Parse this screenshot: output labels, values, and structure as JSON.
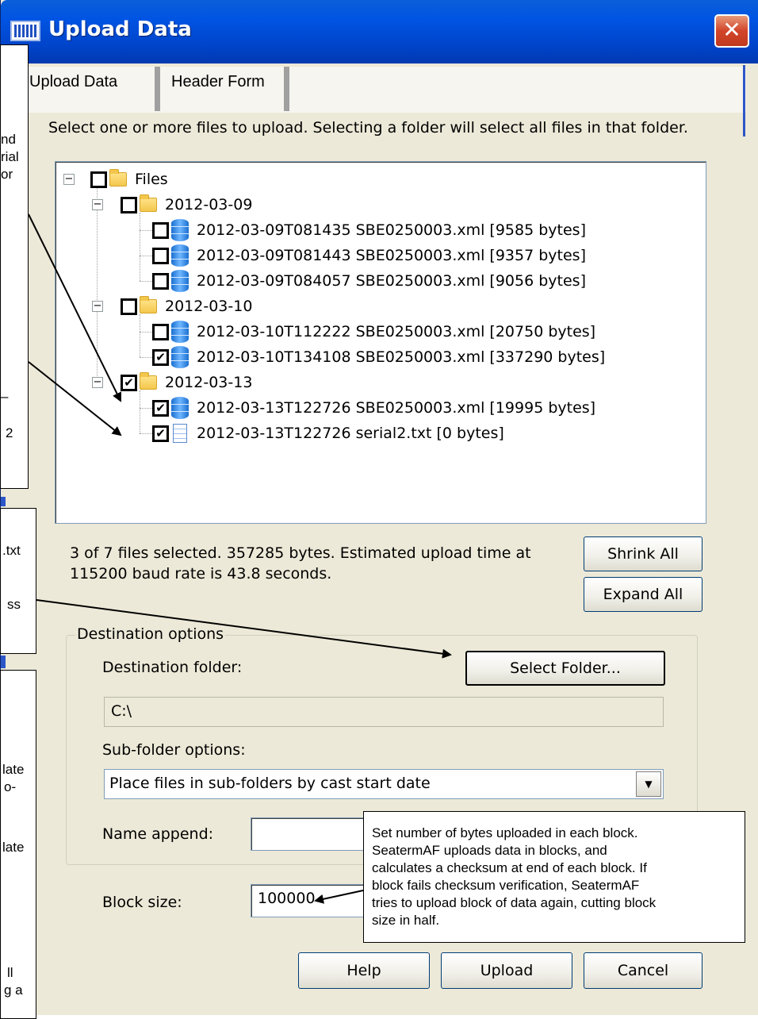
{
  "window": {
    "title": "Upload Data",
    "close_label": "✕"
  },
  "tabs": [
    {
      "label": "Upload Data",
      "active": true
    },
    {
      "label": "Header Form",
      "active": false
    }
  ],
  "instruction": "Select one or more files to upload.  Selecting a folder will select all files in that folder.",
  "tree": {
    "root": {
      "label": "Files",
      "checked": false
    },
    "folders": [
      {
        "label": "2012-03-09",
        "checked": false,
        "files": [
          {
            "label": "2012-03-09T081435 SBE0250003.xml [9585 bytes]",
            "checked": false,
            "icon": "database-icon"
          },
          {
            "label": "2012-03-09T081443 SBE0250003.xml [9357 bytes]",
            "checked": false,
            "icon": "database-icon"
          },
          {
            "label": "2012-03-09T084057 SBE0250003.xml [9056 bytes]",
            "checked": false,
            "icon": "database-icon"
          }
        ]
      },
      {
        "label": "2012-03-10",
        "checked": false,
        "files": [
          {
            "label": "2012-03-10T112222 SBE0250003.xml [20750 bytes]",
            "checked": false,
            "icon": "database-icon"
          },
          {
            "label": "2012-03-10T134108 SBE0250003.xml [337290 bytes]",
            "checked": true,
            "icon": "database-icon"
          }
        ]
      },
      {
        "label": "2012-03-13",
        "checked": true,
        "files": [
          {
            "label": "2012-03-13T122726 SBE0250003.xml [19995 bytes]",
            "checked": true,
            "icon": "database-icon"
          },
          {
            "label": "2012-03-13T122726 serial2.txt [0 bytes]",
            "checked": true,
            "icon": "text-file-icon"
          }
        ]
      }
    ]
  },
  "status": {
    "line1": "3 of 7 files selected. 357285 bytes. Estimated upload time at",
    "line2": "115200 baud rate is 43.8 seconds."
  },
  "buttons": {
    "shrink_all": "Shrink All",
    "expand_all": "Expand All",
    "select_folder": "Select Folder...",
    "help": "Help",
    "upload": "Upload",
    "cancel": "Cancel"
  },
  "destination": {
    "group_label": "Destination options",
    "folder_label": "Destination folder:",
    "folder_value": "C:\\",
    "subfolder_label": "Sub-folder options:",
    "subfolder_value": "Place files in sub-folders by cast start date",
    "name_append_label": "Name append:",
    "name_append_value": ""
  },
  "block": {
    "label": "Block size:",
    "value": "100000"
  },
  "callouts": {
    "top_left": [
      "nd",
      "rial",
      "or",
      "",
      "",
      "",
      "",
      "",
      "",
      "",
      "",
      "",
      "",
      "",
      "–",
      "",
      "2"
    ],
    "middle_left": [
      ".txt",
      "",
      "",
      "ss"
    ],
    "bottom_left": [
      "late",
      "o-",
      "",
      "",
      "late",
      "",
      "",
      "",
      "",
      "",
      "",
      "ll",
      "g a"
    ],
    "block_size": [
      "Set number of bytes uploaded in each block.",
      "SeatermAF uploads data in blocks, and",
      "calculates a checksum at end of each block. If",
      "block fails checksum verification, SeatermAF",
      "tries to upload block of data again, cutting block",
      "size in half."
    ]
  }
}
